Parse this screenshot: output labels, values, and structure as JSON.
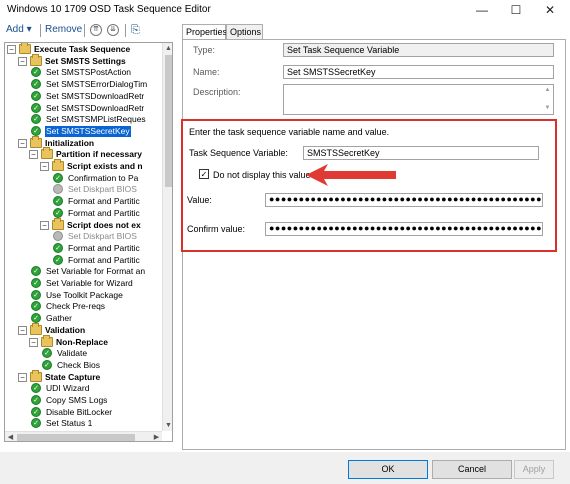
{
  "window": {
    "title": "Windows 10 1709 OSD Task Sequence Editor",
    "minimize": "—",
    "maximize": "☐",
    "close": "✕"
  },
  "toolbar": {
    "add_label": "Add ▾",
    "remove_label": "Remove",
    "move_up_glyph": "⇈",
    "move_down_glyph": "⇊",
    "icon_glyph": "⎘"
  },
  "tree": {
    "nodes": [
      {
        "label": "Execute Task Sequence",
        "kind": "group",
        "level": 0,
        "expander": "−"
      },
      {
        "label": "Set SMSTS Settings",
        "kind": "group",
        "level": 1,
        "expander": "−"
      },
      {
        "label": "Set SMSTSPostAction",
        "kind": "step",
        "level": 2
      },
      {
        "label": "Set SMSTSErrorDialogTim",
        "kind": "step",
        "level": 2
      },
      {
        "label": "Set SMSTSDownloadRetr",
        "kind": "step",
        "level": 2
      },
      {
        "label": "Set SMSTSDownloadRetr",
        "kind": "step",
        "level": 2
      },
      {
        "label": "Set SMSTSMPListReques",
        "kind": "step",
        "level": 2
      },
      {
        "label": "Set SMSTSSecretKey",
        "kind": "step",
        "level": 2,
        "selected": true
      },
      {
        "label": "Initialization",
        "kind": "group",
        "level": 1,
        "expander": "−"
      },
      {
        "label": "Partition if necessary",
        "kind": "group",
        "level": 2,
        "expander": "−"
      },
      {
        "label": "Script exists and n",
        "kind": "group",
        "level": 3,
        "expander": "−"
      },
      {
        "label": "Confirmation to Pa",
        "kind": "step",
        "level": 4
      },
      {
        "label": "Set Diskpart BIOS",
        "kind": "disabled",
        "level": 4
      },
      {
        "label": "Format and Partitic",
        "kind": "step",
        "level": 4
      },
      {
        "label": "Format and Partitic",
        "kind": "step",
        "level": 4
      },
      {
        "label": "Script does not ex",
        "kind": "group",
        "level": 3,
        "expander": "−"
      },
      {
        "label": "Set Diskpart BIOS",
        "kind": "disabled",
        "level": 4
      },
      {
        "label": "Format and Partitic",
        "kind": "step",
        "level": 4
      },
      {
        "label": "Format and Partitic",
        "kind": "step",
        "level": 4
      },
      {
        "label": "Set Variable for Format an",
        "kind": "step",
        "level": 2
      },
      {
        "label": "Set Variable for Wizard",
        "kind": "step",
        "level": 2
      },
      {
        "label": "Use Toolkit Package",
        "kind": "step",
        "level": 2
      },
      {
        "label": "Check Pre-reqs",
        "kind": "step",
        "level": 2
      },
      {
        "label": "Gather",
        "kind": "step",
        "level": 2
      },
      {
        "label": "Validation",
        "kind": "group",
        "level": 1,
        "expander": "−"
      },
      {
        "label": "Non-Replace",
        "kind": "group",
        "level": 2,
        "expander": "−"
      },
      {
        "label": "Validate",
        "kind": "step",
        "level": 3
      },
      {
        "label": "Check Bios",
        "kind": "step",
        "level": 3
      },
      {
        "label": "State Capture",
        "kind": "group",
        "level": 1,
        "expander": "−"
      },
      {
        "label": "UDI Wizard",
        "kind": "step",
        "level": 2
      },
      {
        "label": "Copy SMS Logs",
        "kind": "step",
        "level": 2
      },
      {
        "label": "Disable BitLocker",
        "kind": "step",
        "level": 2
      },
      {
        "label": "Set Status 1",
        "kind": "step",
        "level": 2
      }
    ]
  },
  "tabs": {
    "properties": "Properties",
    "options": "Options"
  },
  "properties": {
    "type_label": "Type:",
    "type_value": "Set Task Sequence Variable",
    "name_label": "Name:",
    "name_value": "Set SMSTSSecretKey",
    "description_label": "Description:",
    "description_value": "",
    "instructions": "Enter the task sequence variable name and value.",
    "variable_label": "Task Sequence Variable:",
    "variable_value": "SMSTSSecretKey",
    "hide_value_label": "Do not display this value",
    "hide_value_checked": "✓",
    "value_label": "Value:",
    "value_masked": "●●●●●●●●●●●●●●●●●●●●●●●●●●●●●●●●●●●●●●●●●●●●●●●●",
    "confirm_label": "Confirm value:",
    "confirm_masked": "●●●●●●●●●●●●●●●●●●●●●●●●●●●●●●●●●●●●●●●●●●●●●●●●"
  },
  "buttons": {
    "ok": "OK",
    "cancel": "Cancel",
    "apply": "Apply"
  },
  "colors": {
    "highlight_box": "#d9312b",
    "arrow": "#e03a34",
    "selection": "#0a64d2"
  }
}
